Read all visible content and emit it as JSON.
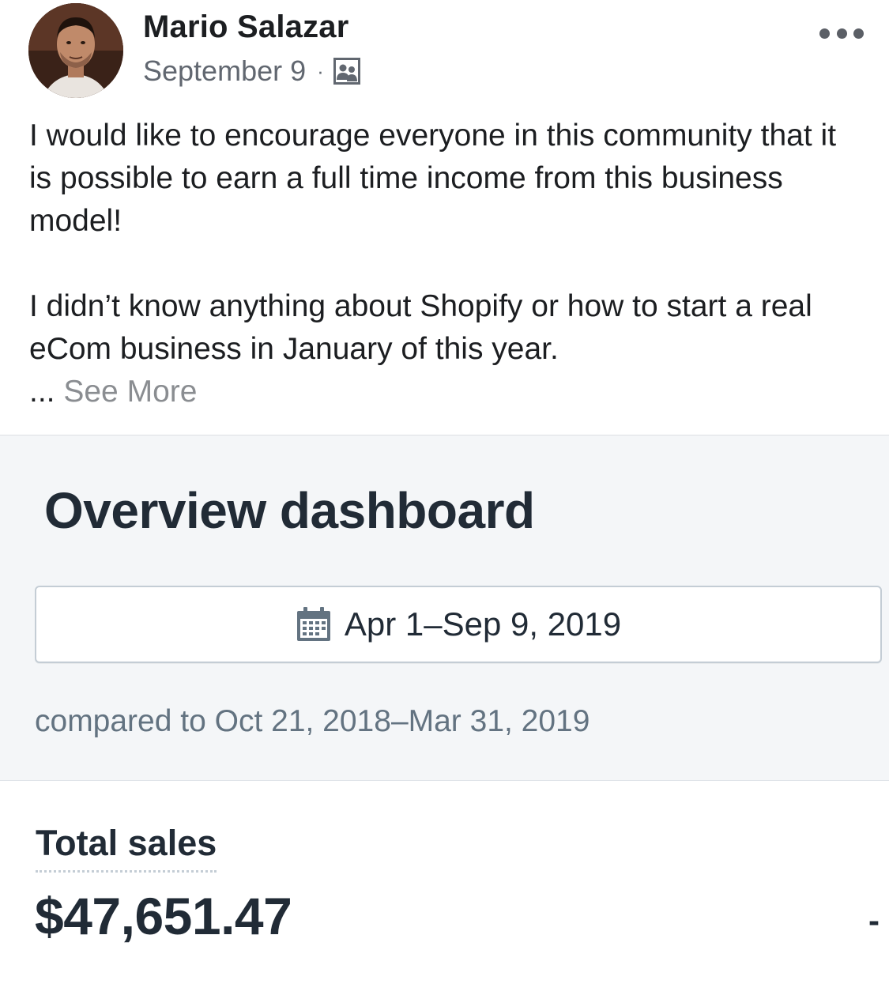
{
  "post": {
    "author": "Mario Salazar",
    "date": "September 9",
    "meta_separator": "·",
    "audience_icon": "group-icon",
    "more_icon": "more-horizontal-icon",
    "body_paragraphs": [
      "I would like to encourage everyone in this community that it is possible to earn a full time income from this business model!",
      "I didn’t know anything about Shopify or how to start a real eCom business in January of this year."
    ],
    "ellipsis": "...",
    "see_more": "See More"
  },
  "dashboard": {
    "title": "Overview dashboard",
    "date_range_icon": "calendar-icon",
    "date_range": "Apr 1–Sep 9, 2019",
    "comparison": "compared to Oct 21, 2018–Mar 31, 2019",
    "metric_label": "Total sales",
    "metric_value": "$47,651.47",
    "metric_change": "-"
  },
  "colors": {
    "text_primary": "#1c1e21",
    "text_secondary": "#616770",
    "see_more": "#8a8d91",
    "dashboard_bg": "#f4f6f8",
    "dashboard_text": "#212b36",
    "dashboard_subdued": "#637381"
  }
}
